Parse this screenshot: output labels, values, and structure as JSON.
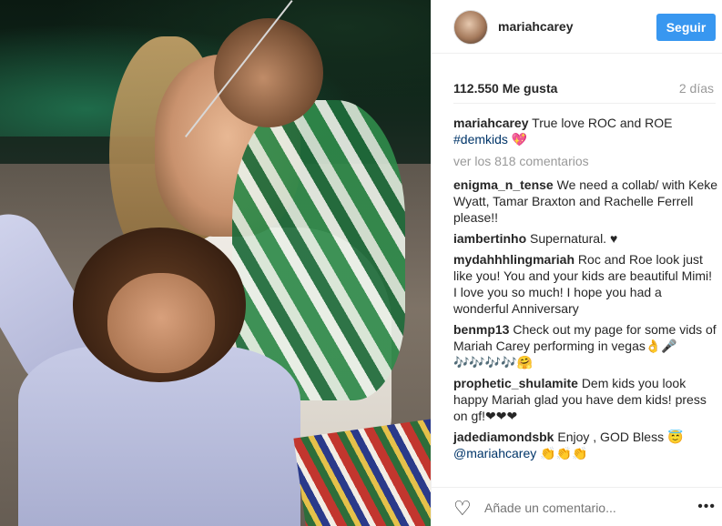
{
  "post": {
    "username": "mariahcarey",
    "follow_label": "Seguir",
    "likes": "112.550 Me gusta",
    "age": "2 días"
  },
  "caption": {
    "username": "mariahcarey",
    "text": "True love ROC and ROE",
    "hashtag": "#demkids",
    "emoji": "💖"
  },
  "view_more": "ver los 818 comentarios",
  "comments": [
    {
      "username": "enigma_n_tense",
      "text": "We need a collab/ with Keke Wyatt, Tamar Braxton and Rachelle Ferrell please!!"
    },
    {
      "username": "iambertinho",
      "text": "Supernatural. ♥"
    },
    {
      "username": "mydahhhlingmariah",
      "text": "Roc and Roe look just like you! You and your kids are beautiful Mimi! I love you so much! I hope you had a wonderful Anniversary"
    },
    {
      "username": "benmp13",
      "text": "Check out my page for some vids of Mariah Carey performing in vegas👌🎤🎶🎶🎶🎶🤗"
    },
    {
      "username": "prophetic_shulamite",
      "text": "Dem kids you look happy Mariah glad you have dem kids! press on gf!❤❤❤"
    },
    {
      "username": "jadediamondsbk",
      "text": "Enjoy , GOD Bless 😇",
      "mention": "@mariahcarey",
      "after": "👏👏👏"
    }
  ],
  "footer": {
    "placeholder": "Añade un comentario...",
    "like_icon": "heart-outline-icon",
    "options_icon": "more-options-icon",
    "options_glyph": "•••"
  },
  "colors": {
    "follow": "#3897f0",
    "tag": "#003569",
    "muted": "#999999"
  }
}
